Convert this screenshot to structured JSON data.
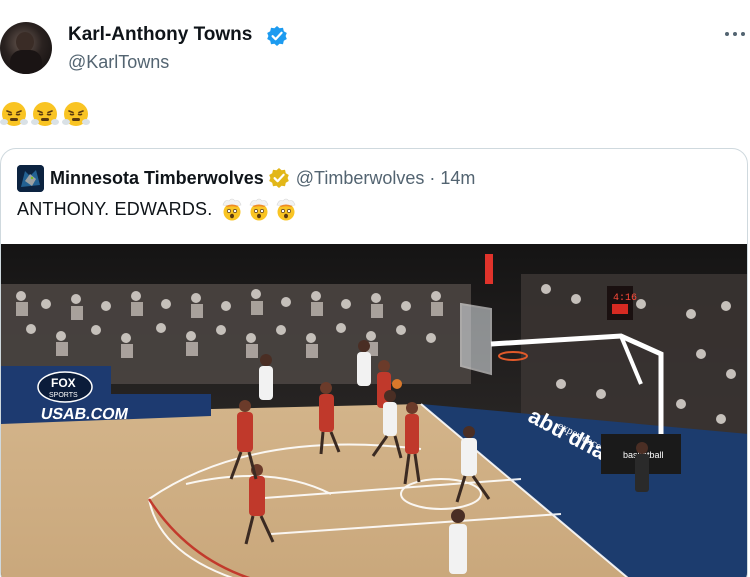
{
  "tweet": {
    "author_name": "Karl-Anthony Towns",
    "author_handle": "@KarlTowns",
    "verified_color": "#1d9bf0",
    "body_emojis": [
      "face-with-steam-icon",
      "face-with-steam-icon",
      "face-with-steam-icon"
    ]
  },
  "quote": {
    "author_name": "Minnesota Timberwolves",
    "author_handle": "@Timberwolves",
    "separator": "·",
    "time": "14m",
    "text": "ANTHONY. EDWARDS.",
    "text_emojis": [
      "exploding-head-icon",
      "exploding-head-icon",
      "exploding-head-icon"
    ],
    "badge_color": "#e2b719"
  },
  "media": {
    "description_icon": "basketball-game-video",
    "court_text_1": "USAB.COM",
    "court_text_2": "abu dhabi",
    "court_text_3": "experience",
    "fox_text_1": "FOX",
    "fox_text_2": "SPORTS",
    "shot_clock": "4:16",
    "stanchion_text": "basketball"
  }
}
